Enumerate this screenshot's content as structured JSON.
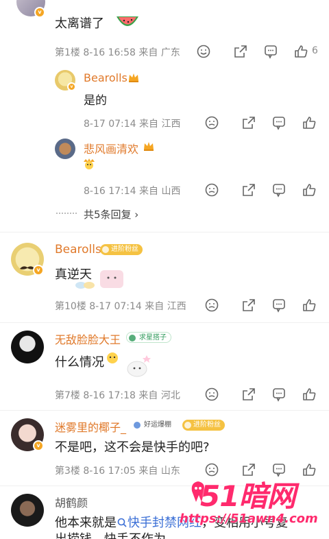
{
  "comments": {
    "c1": {
      "text": "太离谱了",
      "meta": "第1楼 8-16 16:58 来自 广东",
      "likes": "6"
    },
    "r1": {
      "user": "Bearolls",
      "text": "是的",
      "meta": "8-17 07:14 来自 江西"
    },
    "r2": {
      "user": "悲风画清欢",
      "meta": "8-16 17:14 来自 山西"
    },
    "more_replies": "共5条回复 ›",
    "c2": {
      "user": "Bearolls",
      "badge": "进阶粉丝",
      "text": "真逆天",
      "meta": "第10楼 8-17 07:14 来自 江西"
    },
    "c3": {
      "user": "无敌脸脸大王",
      "badge": "求星搭子",
      "text": "什么情况",
      "meta": "第7楼 8-16 17:18 来自 河北"
    },
    "c4": {
      "user": "迷雾里的椰子_",
      "badge1": "好运爆棚",
      "badge2": "进阶粉丝",
      "text": "不是吧，这不会是快手的吧?",
      "meta": "第3楼 8-16 17:05 来自 山东"
    },
    "c5": {
      "user": "胡鹤颜",
      "text_line1_a": "他本来就是",
      "search_link": "快手封禁网红",
      "text_line1_b": "，变相用小号复",
      "text_line2": "出捞钱，快手不作为"
    }
  },
  "watermark": {
    "logo": "51暗网",
    "url": "https://51awn4.com"
  },
  "colors": {
    "username": "#e0792a",
    "meta": "#8a8a8a",
    "link": "#3b6fd6",
    "watermark": "#ff2a6d"
  },
  "icons": [
    "smile-icon",
    "share-icon",
    "comment-icon",
    "like-icon",
    "crown-icon",
    "search-icon"
  ]
}
